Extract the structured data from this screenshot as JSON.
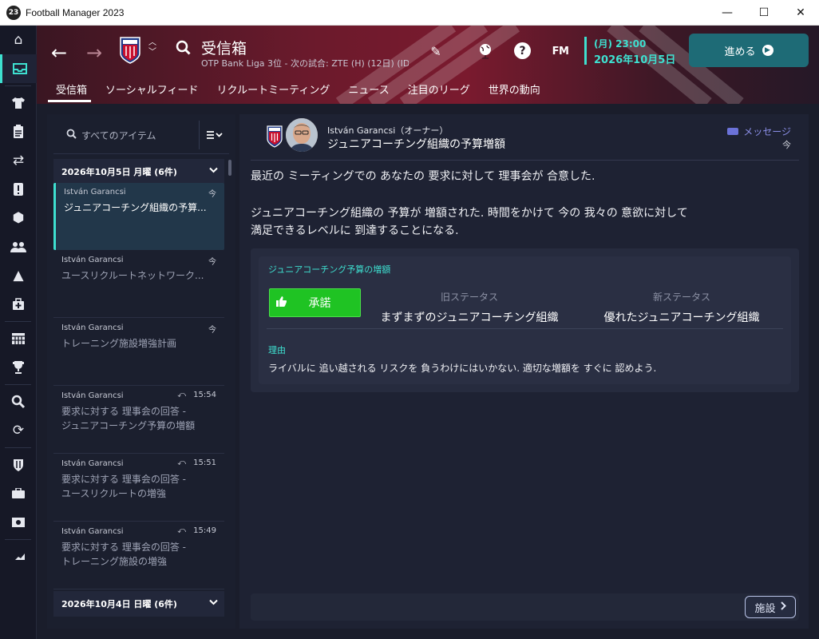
{
  "window": {
    "badge": "23",
    "title": "Football Manager 2023",
    "minimize": "—",
    "maximize": "☐",
    "close": "✕"
  },
  "header": {
    "title": "受信箱",
    "subtitle": "OTP Bank Liga 3位 - 次の試合: ZTE (H) (12日) (ID:...",
    "time": "(月) 23:00",
    "date": "2026年10月5日",
    "continue_label": "進める",
    "fm_label": "FM",
    "help_label": "?"
  },
  "tabs": [
    {
      "label": "受信箱",
      "active": true
    },
    {
      "label": "ソーシャルフィード"
    },
    {
      "label": "リクルートミーティング"
    },
    {
      "label": "ニュース"
    },
    {
      "label": "注目のリーグ"
    },
    {
      "label": "世界の動向"
    }
  ],
  "list": {
    "search_placeholder": "すべてのアイテム",
    "groups": [
      {
        "label": "2026年10月5日 月曜 (6件)"
      },
      {
        "label": "2026年10月4日 日曜 (6件)"
      }
    ],
    "items": [
      {
        "sender": "István Garancsi",
        "time": "今",
        "subject": "ジュニアコーチング組織の予算...",
        "subject2": "",
        "selected": true
      },
      {
        "sender": "István Garancsi",
        "time": "今",
        "subject": "ユースリクルートネットワーク...",
        "subject2": ""
      },
      {
        "sender": "István Garancsi",
        "time": "今",
        "subject": "トレーニング施設増強計画",
        "subject2": ""
      },
      {
        "sender": "István Garancsi",
        "time": "15:54",
        "subject": "要求に対する 理事会の回答 -",
        "subject2": "ジュニアコーチング予算の増額",
        "replied": true
      },
      {
        "sender": "István Garancsi",
        "time": "15:51",
        "subject": "要求に対する 理事会の回答 -",
        "subject2": "ユースリクルートの増強",
        "replied": true
      },
      {
        "sender": "István Garancsi",
        "time": "15:49",
        "subject": "要求に対する 理事会の回答 -",
        "subject2": "トレーニング施設の増強",
        "replied": true
      }
    ]
  },
  "message": {
    "from": "István Garancsi（オーナー）",
    "subject": "ジュニアコーチング組織の予算増額",
    "tag": "メッセージ",
    "when": "今",
    "body1": "最近の ミーティングでの あなたの 要求に対して 理事会が 合意した.",
    "body2a": "ジュニアコーチング組織の 予算が 増額された. 時間をかけて 今の 我々の 意欲に対して",
    "body2b": "満足できるレベルに 到達することになる.",
    "card": {
      "title": "ジュニアコーチング予算の増額",
      "approve_label": "承諾",
      "old_status_label": "旧ステータス",
      "old_status": "まずまずのジュニアコーチング組織",
      "new_status_label": "新ステータス",
      "new_status": "優れたジュニアコーチング組織",
      "reason_label": "理由",
      "reason": "ライバルに 追い越される リスクを 負うわけにはいかない. 適切な増額を すぐに 認めよう."
    },
    "facility_button": "施設"
  },
  "colors": {
    "accent": "#3ee0d0",
    "approve": "#1fc323",
    "header_red": "#7a1a2e"
  }
}
